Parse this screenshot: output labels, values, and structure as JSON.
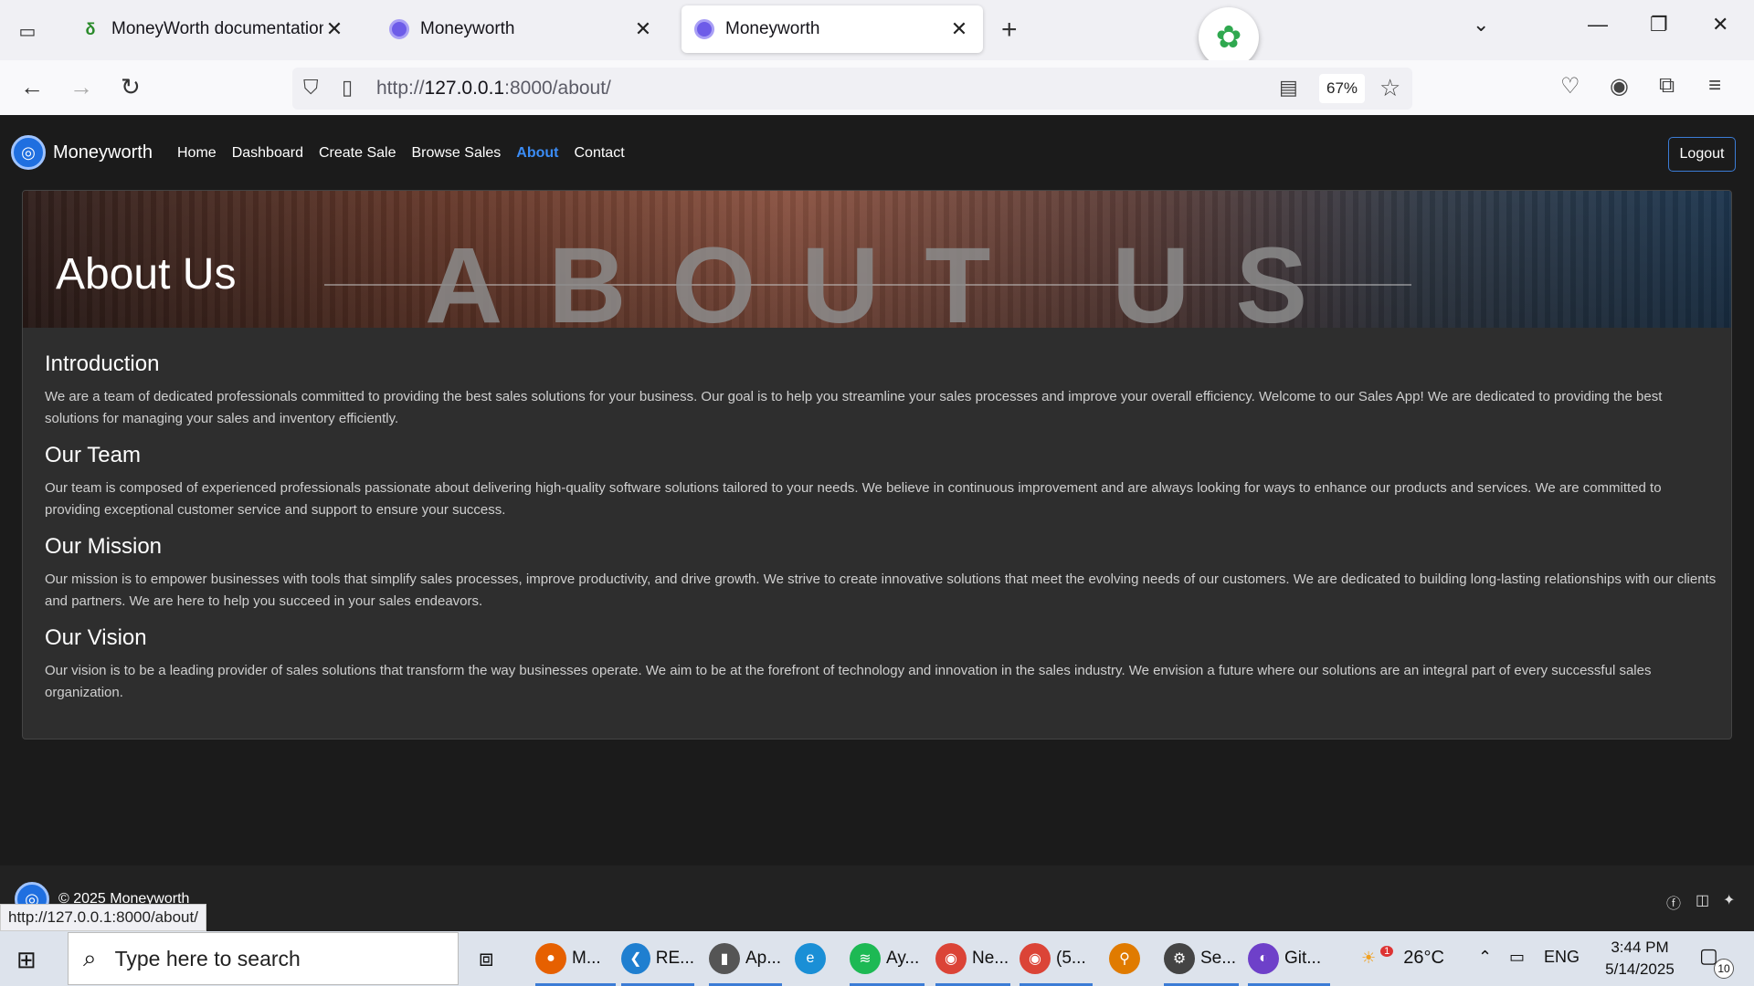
{
  "browser": {
    "tabs": [
      {
        "title": "MoneyWorth documentation - (",
        "active": false
      },
      {
        "title": "Moneyworth",
        "active": false
      },
      {
        "title": "Moneyworth",
        "active": true
      }
    ],
    "url_prefix": "http://",
    "url_host": "127.0.0.1",
    "url_rest": ":8000/about/",
    "zoom": "67%",
    "status_url": "http://127.0.0.1:8000/about/"
  },
  "site": {
    "brand": "Moneyworth",
    "nav": [
      "Home",
      "Dashboard",
      "Create Sale",
      "Browse Sales",
      "About",
      "Contact"
    ],
    "active_nav": "About",
    "logout": "Logout"
  },
  "hero": {
    "title": "About Us",
    "big_text": "ABOUT US"
  },
  "sections": [
    {
      "heading": "Introduction",
      "body": "We are a team of dedicated professionals committed to providing the best sales solutions for your business. Our goal is to help you streamline your sales processes and improve your overall efficiency. Welcome to our Sales App! We are dedicated to providing the best solutions for managing your sales and inventory efficiently."
    },
    {
      "heading": "Our Team",
      "body": "Our team is composed of experienced professionals passionate about delivering high-quality software solutions tailored to your needs. We believe in continuous improvement and are always looking for ways to enhance our products and services. We are committed to providing exceptional customer service and support to ensure your success."
    },
    {
      "heading": "Our Mission",
      "body": "Our mission is to empower businesses with tools that simplify sales processes, improve productivity, and drive growth. We strive to create innovative solutions that meet the evolving needs of our customers. We are dedicated to building long-lasting relationships with our clients and partners. We are here to help you succeed in your sales endeavors."
    },
    {
      "heading": "Our Vision",
      "body": "Our vision is to be a leading provider of sales solutions that transform the way businesses operate. We aim to be at the forefront of technology and innovation in the sales industry. We envision a future where our solutions are an integral part of every successful sales organization."
    }
  ],
  "footer": {
    "copyright": "© 2025 Moneyworth"
  },
  "taskbar": {
    "search_placeholder": "Type here to search",
    "apps": [
      {
        "label": "M...",
        "icon": "firefox-icon",
        "color": "#e66000"
      },
      {
        "label": "RE...",
        "icon": "vscode-icon",
        "color": "#1f7fd0"
      },
      {
        "label": "Ap...",
        "icon": "book-icon",
        "color": "#555555"
      },
      {
        "label": "",
        "icon": "edge-icon",
        "color": "#1a8fd6"
      },
      {
        "label": "Ay...",
        "icon": "spotify-icon",
        "color": "#1db954"
      },
      {
        "label": "Ne...",
        "icon": "chrome-icon",
        "color": "#db4437"
      },
      {
        "label": "(5...",
        "icon": "chrome-icon",
        "color": "#db4437"
      },
      {
        "label": "",
        "icon": "search-tool-icon",
        "color": "#e07b00"
      },
      {
        "label": "Se...",
        "icon": "settings-icon",
        "color": "#444444"
      },
      {
        "label": "Git...",
        "icon": "github-icon",
        "color": "#6e40c9"
      }
    ],
    "weather": "26°C",
    "weather_badge": "1",
    "lang": "ENG",
    "time": "3:44 PM",
    "date": "5/14/2025",
    "notifications": "10"
  }
}
